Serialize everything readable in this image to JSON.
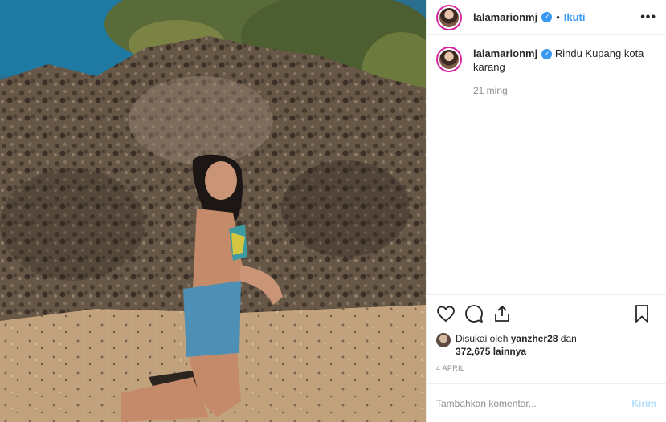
{
  "post": {
    "username": "lalamarionmj",
    "follow_label": "Ikuti",
    "separator": "•",
    "more_label": "•••",
    "verified_mark": "✓"
  },
  "caption": {
    "username": "lalamarionmj",
    "text": "Rindu Kupang kota karang",
    "time": "21 ming"
  },
  "likes": {
    "prefix": "Disukai oleh",
    "user": "yanzher28",
    "middle": "dan",
    "count": "372,675 lainnya"
  },
  "date": "4 APRIL",
  "comment": {
    "placeholder": "Tambahkan komentar...",
    "send_label": "Kirim"
  },
  "icons": [
    "heart-icon",
    "comment-icon",
    "share-icon",
    "bookmark-icon"
  ],
  "colors": {
    "accent": "#3897f0",
    "send_disabled": "#b2dffc",
    "muted": "#8e8e8e"
  }
}
